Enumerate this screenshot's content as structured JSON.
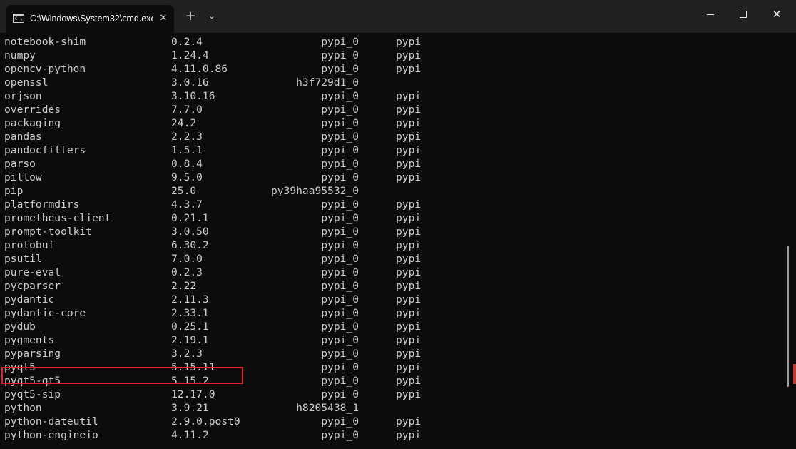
{
  "window": {
    "tab_title": "C:\\Windows\\System32\\cmd.exe",
    "tab_icon_text": "C:\\",
    "close_tab_glyph": "✕",
    "new_tab_glyph": "+",
    "dropdown_glyph": "⌄",
    "close_window_glyph": "✕"
  },
  "colors": {
    "background": "#0c0c0c",
    "titlebar": "#202020",
    "text": "#cccccc",
    "highlight_border": "#e0242a"
  },
  "packages": [
    {
      "name": "notebook-shim",
      "version": "0.2.4",
      "build": "pypi_0",
      "channel": "pypi"
    },
    {
      "name": "numpy",
      "version": "1.24.4",
      "build": "pypi_0",
      "channel": "pypi"
    },
    {
      "name": "opencv-python",
      "version": "4.11.0.86",
      "build": "pypi_0",
      "channel": "pypi"
    },
    {
      "name": "openssl",
      "version": "3.0.16",
      "build": "h3f729d1_0",
      "channel": ""
    },
    {
      "name": "orjson",
      "version": "3.10.16",
      "build": "pypi_0",
      "channel": "pypi"
    },
    {
      "name": "overrides",
      "version": "7.7.0",
      "build": "pypi_0",
      "channel": "pypi"
    },
    {
      "name": "packaging",
      "version": "24.2",
      "build": "pypi_0",
      "channel": "pypi"
    },
    {
      "name": "pandas",
      "version": "2.2.3",
      "build": "pypi_0",
      "channel": "pypi"
    },
    {
      "name": "pandocfilters",
      "version": "1.5.1",
      "build": "pypi_0",
      "channel": "pypi"
    },
    {
      "name": "parso",
      "version": "0.8.4",
      "build": "pypi_0",
      "channel": "pypi"
    },
    {
      "name": "pillow",
      "version": "9.5.0",
      "build": "pypi_0",
      "channel": "pypi"
    },
    {
      "name": "pip",
      "version": "25.0",
      "build": "py39haa95532_0",
      "channel": ""
    },
    {
      "name": "platformdirs",
      "version": "4.3.7",
      "build": "pypi_0",
      "channel": "pypi"
    },
    {
      "name": "prometheus-client",
      "version": "0.21.1",
      "build": "pypi_0",
      "channel": "pypi"
    },
    {
      "name": "prompt-toolkit",
      "version": "3.0.50",
      "build": "pypi_0",
      "channel": "pypi"
    },
    {
      "name": "protobuf",
      "version": "6.30.2",
      "build": "pypi_0",
      "channel": "pypi"
    },
    {
      "name": "psutil",
      "version": "7.0.0",
      "build": "pypi_0",
      "channel": "pypi"
    },
    {
      "name": "pure-eval",
      "version": "0.2.3",
      "build": "pypi_0",
      "channel": "pypi"
    },
    {
      "name": "pycparser",
      "version": "2.22",
      "build": "pypi_0",
      "channel": "pypi"
    },
    {
      "name": "pydantic",
      "version": "2.11.3",
      "build": "pypi_0",
      "channel": "pypi"
    },
    {
      "name": "pydantic-core",
      "version": "2.33.1",
      "build": "pypi_0",
      "channel": "pypi"
    },
    {
      "name": "pydub",
      "version": "0.25.1",
      "build": "pypi_0",
      "channel": "pypi"
    },
    {
      "name": "pygments",
      "version": "2.19.1",
      "build": "pypi_0",
      "channel": "pypi"
    },
    {
      "name": "pyparsing",
      "version": "3.2.3",
      "build": "pypi_0",
      "channel": "pypi"
    },
    {
      "name": "pyqt5",
      "version": "5.15.11",
      "build": "pypi_0",
      "channel": "pypi"
    },
    {
      "name": "pyqt5-qt5",
      "version": "5.15.2",
      "build": "pypi_0",
      "channel": "pypi"
    },
    {
      "name": "pyqt5-sip",
      "version": "12.17.0",
      "build": "pypi_0",
      "channel": "pypi"
    },
    {
      "name": "python",
      "version": "3.9.21",
      "build": "h8205438_1",
      "channel": ""
    },
    {
      "name": "python-dateutil",
      "version": "2.9.0.post0",
      "build": "pypi_0",
      "channel": "pypi"
    },
    {
      "name": "python-engineio",
      "version": "4.11.2",
      "build": "pypi_0",
      "channel": "pypi"
    }
  ],
  "highlighted_package": "python"
}
